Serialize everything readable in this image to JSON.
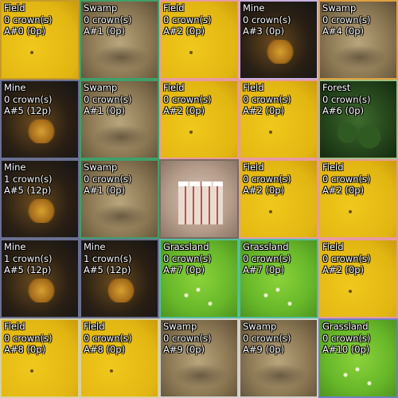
{
  "board": {
    "tiles": [
      {
        "terrain": "Field",
        "crowns": "0 crown(s)",
        "owner": "A#0 (0p)",
        "type": "field",
        "border": "#c79a2a"
      },
      {
        "terrain": "Swamp",
        "crowns": "0 crown(s)",
        "owner": "A#1 (0p)",
        "type": "swamp",
        "border": "#3fa06a"
      },
      {
        "terrain": "Field",
        "crowns": "0 crown(s)",
        "owner": "A#2 (0p)",
        "type": "field",
        "border": "#e89aa0"
      },
      {
        "terrain": "Mine",
        "crowns": "0 crown(s)",
        "owner": "A#3 (0p)",
        "type": "mine",
        "border": "#c8b0e0"
      },
      {
        "terrain": "Swamp",
        "crowns": "0 crown(s)",
        "owner": "A#4 (0p)",
        "type": "swamp",
        "border": "#e0a040"
      },
      {
        "terrain": "Mine",
        "crowns": "0 crown(s)",
        "owner": "A#5 (12p)",
        "type": "mine",
        "border": "#6a7090"
      },
      {
        "terrain": "Swamp",
        "crowns": "0 crown(s)",
        "owner": "A#1 (0p)",
        "type": "swamp",
        "border": "#3fa06a"
      },
      {
        "terrain": "Field",
        "crowns": "0 crown(s)",
        "owner": "A#2 (0p)",
        "type": "field",
        "border": "#e89aa0"
      },
      {
        "terrain": "Field",
        "crowns": "0 crown(s)",
        "owner": "A#2 (0p)",
        "type": "field",
        "border": "#e89aa0"
      },
      {
        "terrain": "Forest",
        "crowns": "0 crown(s)",
        "owner": "A#6 (0p)",
        "type": "forest",
        "border": "#a0c080"
      },
      {
        "terrain": "Mine",
        "crowns": "1 crown(s)",
        "owner": "A#5 (12p)",
        "type": "mine",
        "border": "#6a7090"
      },
      {
        "terrain": "Swamp",
        "crowns": "0 crown(s)",
        "owner": "A#1 (0p)",
        "type": "swamp",
        "border": "#3fa06a"
      },
      {
        "terrain": "",
        "crowns": "",
        "owner": "",
        "type": "castle",
        "border": "#7a6a60"
      },
      {
        "terrain": "Field",
        "crowns": "0 crown(s)",
        "owner": "A#2 (0p)",
        "type": "field",
        "border": "#e89aa0"
      },
      {
        "terrain": "Field",
        "crowns": "0 crown(s)",
        "owner": "A#2 (0p)",
        "type": "field",
        "border": "#e89aa0"
      },
      {
        "terrain": "Mine",
        "crowns": "1 crown(s)",
        "owner": "A#5 (12p)",
        "type": "mine",
        "border": "#6a7090"
      },
      {
        "terrain": "Mine",
        "crowns": "1 crown(s)",
        "owner": "A#5 (12p)",
        "type": "mine",
        "border": "#6a7090"
      },
      {
        "terrain": "Grassland",
        "crowns": "0 crown(s)",
        "owner": "A#7 (0p)",
        "type": "grassland",
        "border": "#50c0a0"
      },
      {
        "terrain": "Grassland",
        "crowns": "0 crown(s)",
        "owner": "A#7 (0p)",
        "type": "grassland",
        "border": "#50c0a0"
      },
      {
        "terrain": "Field",
        "crowns": "0 crown(s)",
        "owner": "A#2 (0p)",
        "type": "field",
        "border": "#e89aa0"
      },
      {
        "terrain": "Field",
        "crowns": "0 crown(s)",
        "owner": "A#8 (0p)",
        "type": "field",
        "border": "#d8d0a0"
      },
      {
        "terrain": "Field",
        "crowns": "0 crown(s)",
        "owner": "A#8 (0p)",
        "type": "field",
        "border": "#d8d0a0"
      },
      {
        "terrain": "Swamp",
        "crowns": "0 crown(s)",
        "owner": "A#9 (0p)",
        "type": "swamp",
        "border": "#d0d0d0"
      },
      {
        "terrain": "Swamp",
        "crowns": "0 crown(s)",
        "owner": "A#9 (0p)",
        "type": "swamp",
        "border": "#d0d0d0"
      },
      {
        "terrain": "Grassland",
        "crowns": "0 crown(s)",
        "owner": "A#10 (0p)",
        "type": "grassland",
        "border": "#7080c0"
      }
    ]
  }
}
